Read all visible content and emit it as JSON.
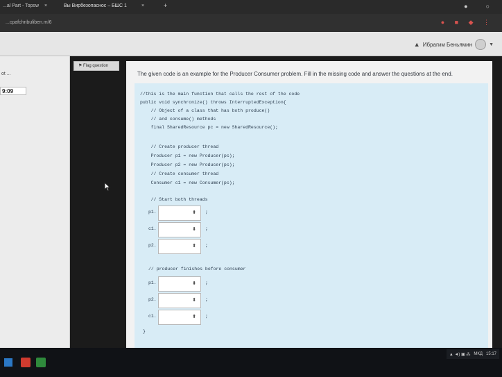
{
  "browser": {
    "tab1_label": "...al Part - Topsw",
    "tab1_close": "×",
    "tab2_label": "Вы Вирбезопаснос – БШС 1",
    "tab2_close": "×",
    "new_tab": "+",
    "url": "...cpafchnbuliben.m/6"
  },
  "header": {
    "user_name": "Ибрагим Беньямин"
  },
  "sidebar": {
    "title": "ot ...",
    "timer": "9:09"
  },
  "question": {
    "flag_label": "Flag question",
    "text": "The given code is an example for the Producer Consumer problem. Fill in the missing code and answer the questions at the end.",
    "code_lines": [
      "//this is the main function that calls the rest of the code",
      "public void synchronize() throws InterruptedException{",
      "    // Object of a class that has both produce()",
      "    // and consume() methods",
      "    final SharedResource pc = new SharedResource();",
      "",
      "    // Create producer thread",
      "    Producer p1 = new Producer(pc);",
      "    Producer p2 = new Producer(pc);",
      "    // Create consumer thread",
      "    Consumer c1 = new Consumer(pc);",
      "",
      "    // Start both threads"
    ],
    "start_rows": [
      {
        "label": "p1.",
        "suffix": ";"
      },
      {
        "label": "c1.",
        "suffix": ";"
      },
      {
        "label": "p2.",
        "suffix": ";"
      }
    ],
    "comment_finish": "// producer finishes before consumer",
    "join_rows": [
      {
        "label": "p1.",
        "suffix": ";"
      },
      {
        "label": "p2.",
        "suffix": ";"
      },
      {
        "label": "c1.",
        "suffix": ";"
      }
    ],
    "closing_brace": "}",
    "select_arrows": "⬍"
  },
  "taskbar": {
    "language": "МКД",
    "time": "15:17"
  }
}
